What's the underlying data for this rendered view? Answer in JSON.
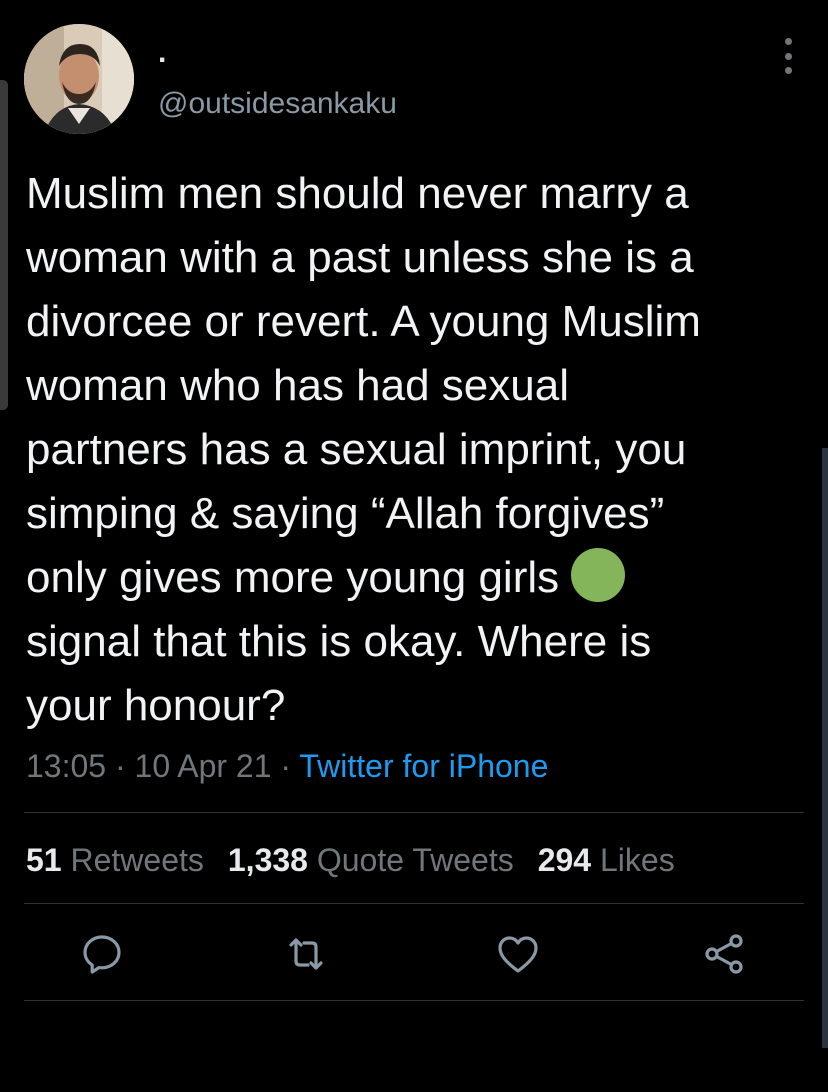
{
  "tweet": {
    "display_name": ".",
    "handle": "@outsidesankaku",
    "text_lines": [
      "Muslim men should never marry a",
      "woman with a past unless she is a",
      "divorcee or revert. A young Muslim",
      "woman who has had sexual",
      "partners has a sexual imprint, you",
      "simping & saying “Allah forgives”",
      "only gives more young girls",
      "signal that this is okay. Where is",
      "your honour?"
    ],
    "time": "13:05",
    "date": "10 Apr 21",
    "separator": "·",
    "source": "Twitter for iPhone"
  },
  "stats": {
    "retweets_count": "51",
    "retweets_label": "Retweets",
    "quotes_count": "1,338",
    "quotes_label": "Quote Tweets",
    "likes_count": "294",
    "likes_label": "Likes"
  },
  "actions": [
    {
      "name": "reply",
      "icon": "reply-icon"
    },
    {
      "name": "retweet",
      "icon": "retweet-icon"
    },
    {
      "name": "like",
      "icon": "heart-icon"
    },
    {
      "name": "share",
      "icon": "share-icon"
    }
  ],
  "colors": {
    "background": "#000000",
    "text": "#e7e9ea",
    "secondary": "#71767b",
    "link": "#1d9bf0",
    "emoji_green": "#85b55a"
  }
}
